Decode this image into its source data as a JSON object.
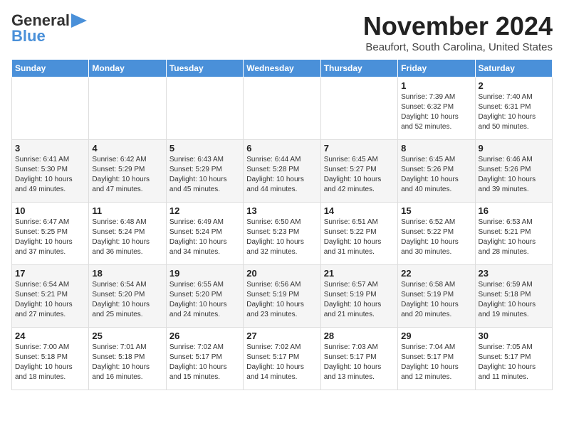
{
  "logo": {
    "line1": "General",
    "line2": "Blue"
  },
  "header": {
    "month": "November 2024",
    "location": "Beaufort, South Carolina, United States"
  },
  "weekdays": [
    "Sunday",
    "Monday",
    "Tuesday",
    "Wednesday",
    "Thursday",
    "Friday",
    "Saturday"
  ],
  "weeks": [
    [
      {
        "day": "",
        "info": ""
      },
      {
        "day": "",
        "info": ""
      },
      {
        "day": "",
        "info": ""
      },
      {
        "day": "",
        "info": ""
      },
      {
        "day": "",
        "info": ""
      },
      {
        "day": "1",
        "info": "Sunrise: 7:39 AM\nSunset: 6:32 PM\nDaylight: 10 hours\nand 52 minutes."
      },
      {
        "day": "2",
        "info": "Sunrise: 7:40 AM\nSunset: 6:31 PM\nDaylight: 10 hours\nand 50 minutes."
      }
    ],
    [
      {
        "day": "3",
        "info": "Sunrise: 6:41 AM\nSunset: 5:30 PM\nDaylight: 10 hours\nand 49 minutes."
      },
      {
        "day": "4",
        "info": "Sunrise: 6:42 AM\nSunset: 5:29 PM\nDaylight: 10 hours\nand 47 minutes."
      },
      {
        "day": "5",
        "info": "Sunrise: 6:43 AM\nSunset: 5:29 PM\nDaylight: 10 hours\nand 45 minutes."
      },
      {
        "day": "6",
        "info": "Sunrise: 6:44 AM\nSunset: 5:28 PM\nDaylight: 10 hours\nand 44 minutes."
      },
      {
        "day": "7",
        "info": "Sunrise: 6:45 AM\nSunset: 5:27 PM\nDaylight: 10 hours\nand 42 minutes."
      },
      {
        "day": "8",
        "info": "Sunrise: 6:45 AM\nSunset: 5:26 PM\nDaylight: 10 hours\nand 40 minutes."
      },
      {
        "day": "9",
        "info": "Sunrise: 6:46 AM\nSunset: 5:26 PM\nDaylight: 10 hours\nand 39 minutes."
      }
    ],
    [
      {
        "day": "10",
        "info": "Sunrise: 6:47 AM\nSunset: 5:25 PM\nDaylight: 10 hours\nand 37 minutes."
      },
      {
        "day": "11",
        "info": "Sunrise: 6:48 AM\nSunset: 5:24 PM\nDaylight: 10 hours\nand 36 minutes."
      },
      {
        "day": "12",
        "info": "Sunrise: 6:49 AM\nSunset: 5:24 PM\nDaylight: 10 hours\nand 34 minutes."
      },
      {
        "day": "13",
        "info": "Sunrise: 6:50 AM\nSunset: 5:23 PM\nDaylight: 10 hours\nand 32 minutes."
      },
      {
        "day": "14",
        "info": "Sunrise: 6:51 AM\nSunset: 5:22 PM\nDaylight: 10 hours\nand 31 minutes."
      },
      {
        "day": "15",
        "info": "Sunrise: 6:52 AM\nSunset: 5:22 PM\nDaylight: 10 hours\nand 30 minutes."
      },
      {
        "day": "16",
        "info": "Sunrise: 6:53 AM\nSunset: 5:21 PM\nDaylight: 10 hours\nand 28 minutes."
      }
    ],
    [
      {
        "day": "17",
        "info": "Sunrise: 6:54 AM\nSunset: 5:21 PM\nDaylight: 10 hours\nand 27 minutes."
      },
      {
        "day": "18",
        "info": "Sunrise: 6:54 AM\nSunset: 5:20 PM\nDaylight: 10 hours\nand 25 minutes."
      },
      {
        "day": "19",
        "info": "Sunrise: 6:55 AM\nSunset: 5:20 PM\nDaylight: 10 hours\nand 24 minutes."
      },
      {
        "day": "20",
        "info": "Sunrise: 6:56 AM\nSunset: 5:19 PM\nDaylight: 10 hours\nand 23 minutes."
      },
      {
        "day": "21",
        "info": "Sunrise: 6:57 AM\nSunset: 5:19 PM\nDaylight: 10 hours\nand 21 minutes."
      },
      {
        "day": "22",
        "info": "Sunrise: 6:58 AM\nSunset: 5:19 PM\nDaylight: 10 hours\nand 20 minutes."
      },
      {
        "day": "23",
        "info": "Sunrise: 6:59 AM\nSunset: 5:18 PM\nDaylight: 10 hours\nand 19 minutes."
      }
    ],
    [
      {
        "day": "24",
        "info": "Sunrise: 7:00 AM\nSunset: 5:18 PM\nDaylight: 10 hours\nand 18 minutes."
      },
      {
        "day": "25",
        "info": "Sunrise: 7:01 AM\nSunset: 5:18 PM\nDaylight: 10 hours\nand 16 minutes."
      },
      {
        "day": "26",
        "info": "Sunrise: 7:02 AM\nSunset: 5:17 PM\nDaylight: 10 hours\nand 15 minutes."
      },
      {
        "day": "27",
        "info": "Sunrise: 7:02 AM\nSunset: 5:17 PM\nDaylight: 10 hours\nand 14 minutes."
      },
      {
        "day": "28",
        "info": "Sunrise: 7:03 AM\nSunset: 5:17 PM\nDaylight: 10 hours\nand 13 minutes."
      },
      {
        "day": "29",
        "info": "Sunrise: 7:04 AM\nSunset: 5:17 PM\nDaylight: 10 hours\nand 12 minutes."
      },
      {
        "day": "30",
        "info": "Sunrise: 7:05 AM\nSunset: 5:17 PM\nDaylight: 10 hours\nand 11 minutes."
      }
    ]
  ]
}
